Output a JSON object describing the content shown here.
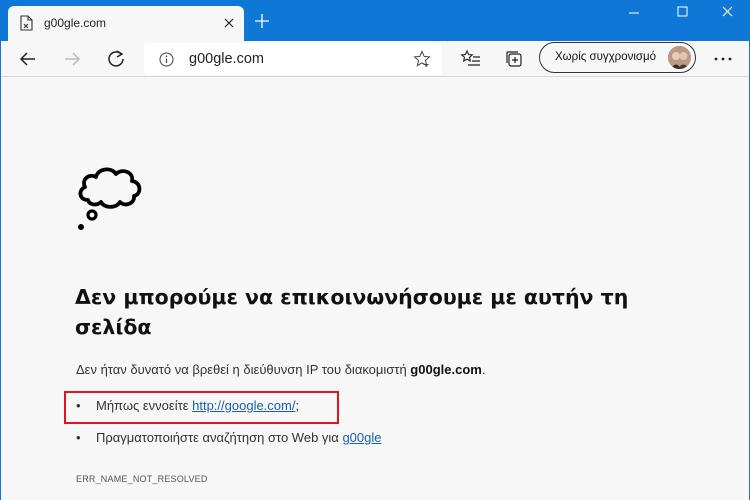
{
  "tab": {
    "title": "g00gle.com",
    "favicon": "broken-page-icon"
  },
  "window_controls": {
    "minimize": "minimize-icon",
    "maximize": "maximize-icon",
    "close": "close-icon"
  },
  "toolbar": {
    "address": "g00gle.com",
    "profile_label": "Χωρίς συγχρονισμό",
    "icons": [
      "back-arrow-icon",
      "forward-arrow-icon",
      "refresh-icon",
      "info-icon",
      "favorite-star-icon",
      "favorites-list-icon",
      "collections-icon",
      "more-menu-icon"
    ]
  },
  "error_page": {
    "icon": "thought-cloud-icon",
    "heading": "Δεν μπορούμε να επικοινωνήσουμε με αυτήν τη σελίδα",
    "description_prefix": "Δεν ήταν δυνατό να βρεθεί η διεύθυνση IP του διακομιστή ",
    "description_host": "g00gle.com",
    "description_suffix": ".",
    "suggestion_1_prefix": "Μήπως εννοείτε ",
    "suggestion_1_link": "http://google.com/",
    "suggestion_1_suffix": ";",
    "suggestion_2_prefix": "Πραγματοποιήστε αναζήτηση στο Web για ",
    "suggestion_2_link": "g00gle",
    "bullet": "•",
    "error_code": "ERR_NAME_NOT_RESOLVED"
  },
  "colors": {
    "titlebar": "#0f78d7",
    "highlight": "#e0141a",
    "link": "#1a5fb4"
  }
}
